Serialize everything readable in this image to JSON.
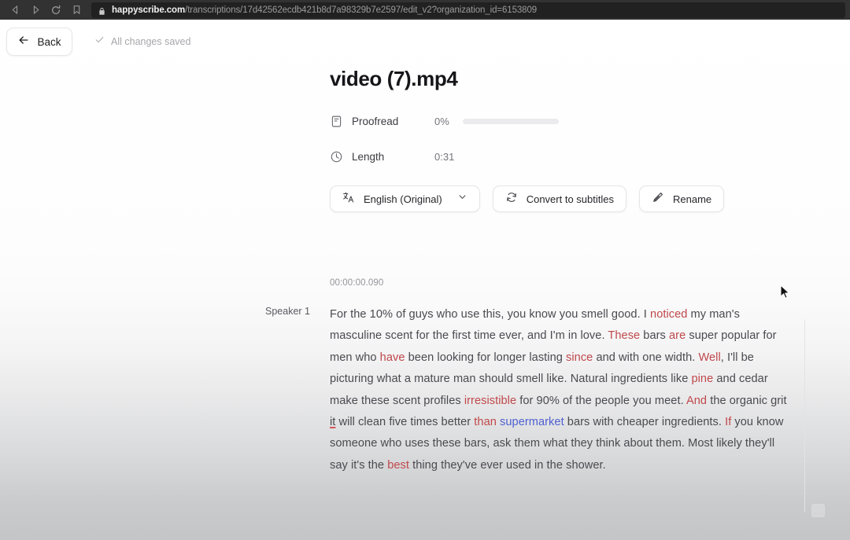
{
  "browser": {
    "nav": {
      "back": "back-arrow-icon",
      "forward": "forward-arrow-icon",
      "reload": "reload-icon",
      "bookmark": "bookmark-icon"
    },
    "lock_icon": "lock-icon",
    "url_domain": "happyscribe.com",
    "url_path": "/transcriptions/17d42562ecdb421b8d7a98329b7e2597/edit_v2?organization_id=6153809"
  },
  "toolbar": {
    "back_label": "Back",
    "back_icon": "arrow-left-icon",
    "saved_icon": "check-icon",
    "saved_label": "All changes saved"
  },
  "file": {
    "title": "video (7).mp4"
  },
  "meta": {
    "proofread": {
      "icon": "document-icon",
      "label": "Proofread",
      "value": "0%",
      "percent": 0
    },
    "length": {
      "icon": "clock-icon",
      "label": "Length",
      "value": "0:31"
    }
  },
  "actions": [
    {
      "name": "language-selector",
      "icon": "translate-icon",
      "label": "English (Original)",
      "chevron": "chevron-down-icon"
    },
    {
      "name": "convert-to-subtitles",
      "icon": "refresh-icon",
      "label": "Convert to subtitles",
      "chevron": null
    },
    {
      "name": "rename",
      "icon": "pencil-icon",
      "label": "Rename",
      "chevron": null
    }
  ],
  "transcript": {
    "timestamp": "00:00:00.090",
    "speaker": "Speaker 1",
    "tokens": [
      {
        "t": "For the 10% of guys who use this, you know you smell good. I "
      },
      {
        "t": "noticed",
        "c": "red"
      },
      {
        "t": " my man's masculine scent for the first time ever, and I'm in love. "
      },
      {
        "t": "These",
        "c": "red"
      },
      {
        "t": " bars "
      },
      {
        "t": "are",
        "c": "red"
      },
      {
        "t": " super popular for men who "
      },
      {
        "t": "have",
        "c": "red"
      },
      {
        "t": " been looking for longer lasting "
      },
      {
        "t": "since",
        "c": "red"
      },
      {
        "t": " and with one width. "
      },
      {
        "t": "Well",
        "c": "red"
      },
      {
        "t": ", I'll be picturing what a mature man should smell like. Natural ingredients like "
      },
      {
        "t": "pine",
        "c": "red"
      },
      {
        "t": " and cedar make these scent profiles "
      },
      {
        "t": "irresistible",
        "c": "red"
      },
      {
        "t": " for 90% of the people you meet. "
      },
      {
        "t": "And",
        "c": "red"
      },
      {
        "t": " the organic grit "
      },
      {
        "t": "it",
        "c": "underline"
      },
      {
        "t": " will clean five times better "
      },
      {
        "t": "than",
        "c": "red"
      },
      {
        "t": " "
      },
      {
        "t": "supermarket",
        "c": "blue"
      },
      {
        "t": " bars with cheaper ingredients. "
      },
      {
        "t": "If",
        "c": "red"
      },
      {
        "t": " you know someone who uses these bars, ask them what they think about them. Most likely they'll say it's the "
      },
      {
        "t": "best",
        "c": "red"
      },
      {
        "t": " thing they've ever used in the shower."
      }
    ]
  },
  "colors": {
    "accent": "#4f46e5",
    "highlight_red": "#c0484b",
    "highlight_blue": "#4e5fd0",
    "chrome_bg": "#323232",
    "omnibox_bg": "#212121"
  }
}
